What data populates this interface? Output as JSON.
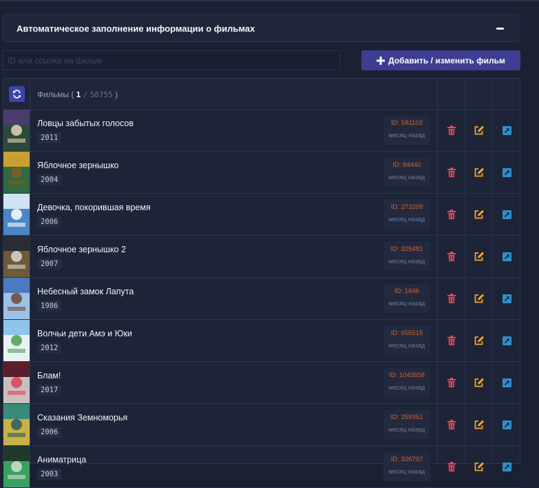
{
  "panel": {
    "title": "Автоматическое заполнение информации о фильмах"
  },
  "search": {
    "placeholder": "ID или ссылка на фильм",
    "value": ""
  },
  "add_button": {
    "label": "Добавить / изменить фильм"
  },
  "films_header": {
    "label": "Фильмы",
    "open": "(",
    "count": "1",
    "separator": "/",
    "total": "58755",
    "close": ")"
  },
  "colors": {
    "accent": "#3d3e92",
    "refresh": "#3b44a8",
    "id_text": "#d2622a",
    "delete": "#e64b5c",
    "edit": "#f0a630",
    "open": "#2f8fce"
  },
  "icons": {
    "collapse": "minus-icon",
    "add": "plus-icon",
    "refresh": "refresh-icon",
    "delete": "trash-icon",
    "edit": "edit-icon",
    "open": "external-link-icon"
  },
  "films": [
    {
      "title": "Ловцы забытых голосов",
      "year": "2011",
      "id": "ID: 581102",
      "time": "месяц назад",
      "poster": [
        "#4a3d6e",
        "#2a4a3a",
        "#e6d3b3"
      ]
    },
    {
      "title": "Яблочное зернышко",
      "year": "2004",
      "id": "ID: 84440",
      "time": "месяц назад",
      "poster": [
        "#c9a030",
        "#2f6a40",
        "#8a5a20"
      ]
    },
    {
      "title": "Девочка, покорившая время",
      "year": "2006",
      "id": "ID: 273209",
      "time": "месяц назад",
      "poster": [
        "#cfe3f3",
        "#4b86c6",
        "#ffffff"
      ]
    },
    {
      "title": "Яблочное зернышко 2",
      "year": "2007",
      "id": "ID: 325481",
      "time": "месяц назад",
      "poster": [
        "#2a2d33",
        "#6e5a3a",
        "#d8d8d8"
      ]
    },
    {
      "title": "Небесный замок Лапута",
      "year": "1986",
      "id": "ID: 1846",
      "time": "месяц назад",
      "poster": [
        "#4a7bc0",
        "#9cc2e6",
        "#6a4a3a"
      ]
    },
    {
      "title": "Волчьи дети Амэ и Юки",
      "year": "2012",
      "id": "ID: 655515",
      "time": "месяц назад",
      "poster": [
        "#8ec5e8",
        "#e8f2f6",
        "#4aa050"
      ]
    },
    {
      "title": "Блам!",
      "year": "2017",
      "id": "ID: 1042658",
      "time": "месяц назад",
      "poster": [
        "#5a1f2a",
        "#c8c0c0",
        "#e04050"
      ]
    },
    {
      "title": "Сказания Земноморья",
      "year": "2006",
      "id": "ID: 259351",
      "time": "месяц назад",
      "poster": [
        "#3a8a7a",
        "#c9b24a",
        "#2a5a5a"
      ]
    },
    {
      "title": "Аниматрица",
      "year": "2003",
      "id": "ID: 326797",
      "time": "месяц назад",
      "poster": [
        "#1f3a2a",
        "#3aa060",
        "#cfe0d0"
      ]
    }
  ]
}
